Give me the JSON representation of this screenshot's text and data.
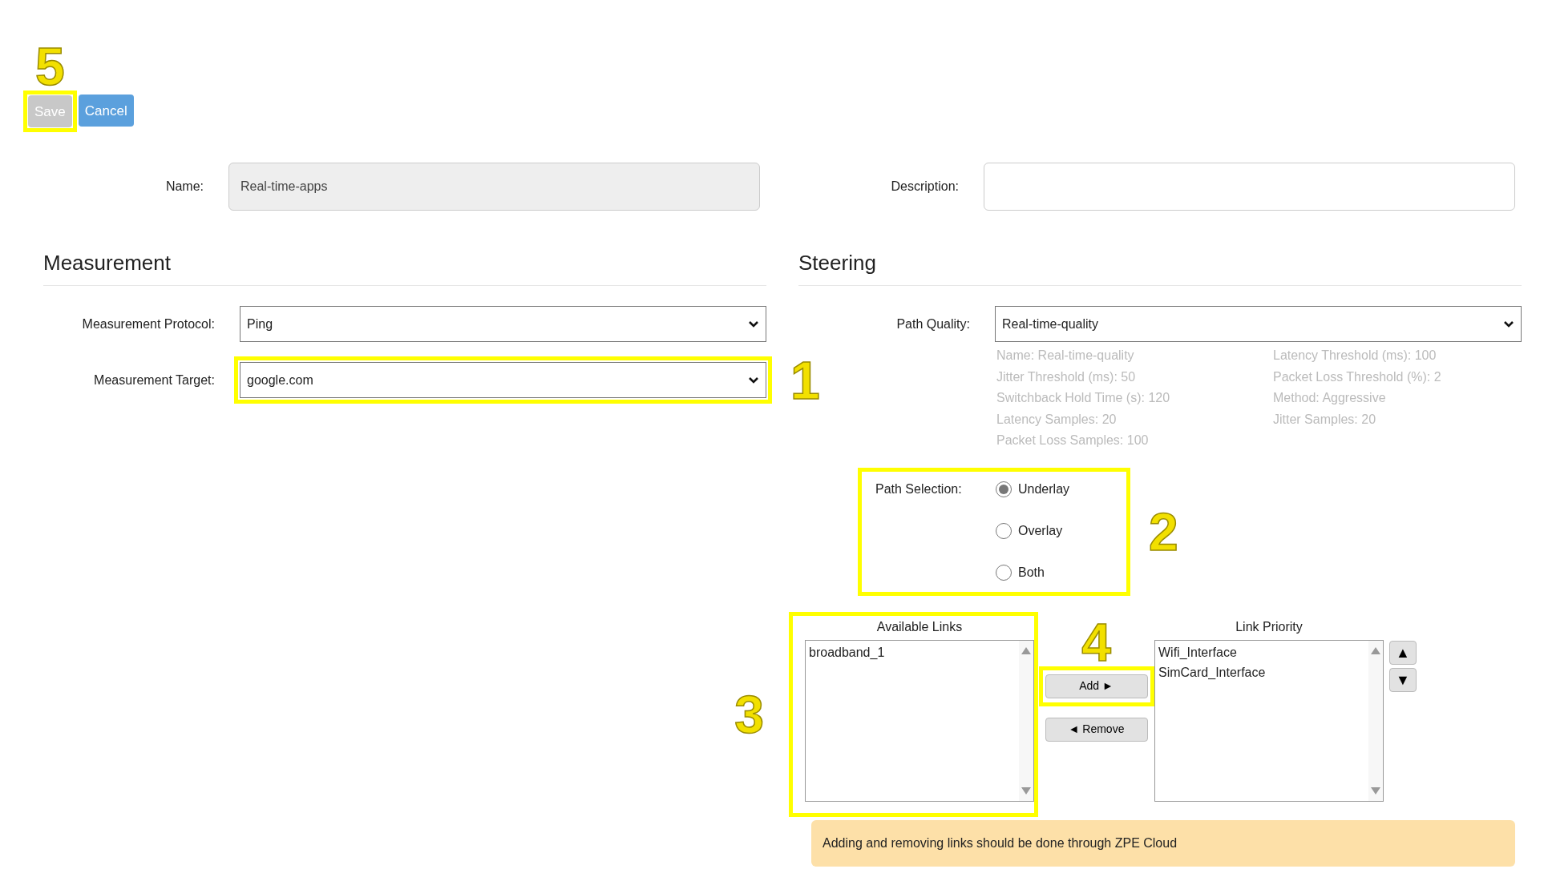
{
  "toolbar": {
    "buttons": [
      {
        "label": "Save",
        "disabled": true,
        "callout": {
          "number": "5"
        }
      },
      {
        "label": "Cancel",
        "disabled": false
      }
    ]
  },
  "name_field": {
    "label": "Name:",
    "value": "Real-time-apps",
    "disabled": true
  },
  "description_field": {
    "label": "Description:"
  },
  "measurement": {
    "title": "Measurement",
    "fields": [
      {
        "label": "Measurement Protocol:",
        "value": "Ping"
      },
      {
        "label": "Measurement Target:",
        "value": "google.com",
        "callout": {
          "number": "1"
        }
      }
    ]
  },
  "steering": {
    "title": "Steering",
    "path_quality": {
      "label": "Path Quality:",
      "value": "Real-time-quality",
      "detail_columns": [
        [
          "Name: Real-time-quality",
          "Jitter Threshold (ms): 50",
          "Switchback Hold Time (s): 120",
          "Latency Samples: 20",
          "Packet Loss Samples: 100"
        ],
        [
          "Latency Threshold (ms): 100",
          "Packet Loss Threshold (%): 2",
          "Method: Aggressive",
          "Jitter Samples: 20"
        ]
      ]
    },
    "path_selection": {
      "label": "Path Selection:",
      "callout": {
        "number": "2"
      },
      "options": [
        {
          "label": "Underlay",
          "selected": true
        },
        {
          "label": "Overlay",
          "selected": false
        },
        {
          "label": "Both",
          "selected": false
        }
      ]
    },
    "available_links": {
      "title": "Available Links",
      "items": [
        "broadband_1"
      ],
      "callout": {
        "number": "3"
      }
    },
    "transfer_buttons": [
      {
        "label": "Add ►",
        "callout": {
          "number": "4"
        }
      },
      {
        "label": "◄ Remove"
      }
    ],
    "link_priority": {
      "title": "Link Priority",
      "items": [
        "Wifi_Interface",
        "SimCard_Interface"
      ]
    },
    "order_buttons": [
      "▲",
      "▼"
    ],
    "note": "Adding and removing links should be done through ZPE Cloud"
  }
}
